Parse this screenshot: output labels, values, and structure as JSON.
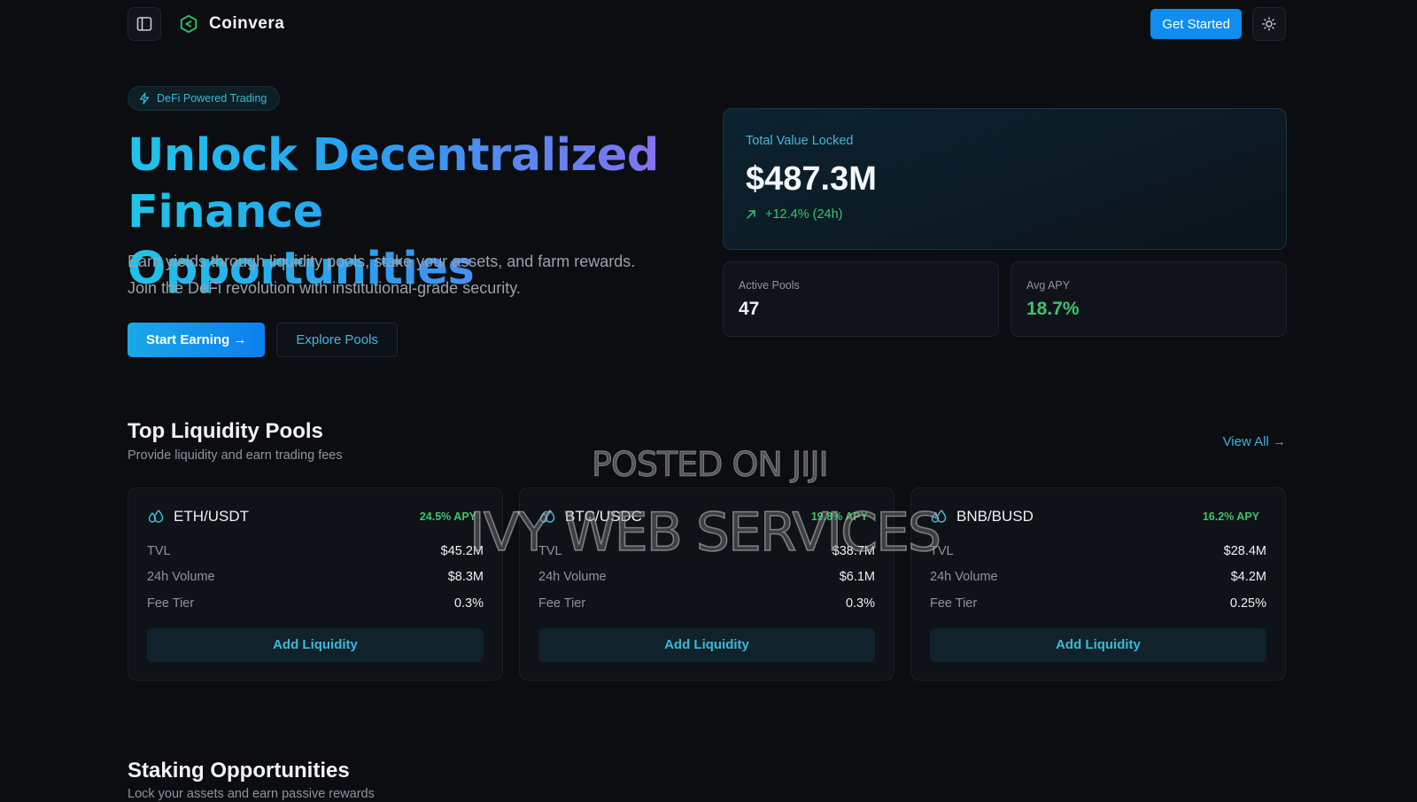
{
  "nav": {
    "brand_name": "Coinvera",
    "cta_label": "Get Started"
  },
  "hero": {
    "badge": "DeFi Powered Trading",
    "title_line1": "Unlock Decentralized",
    "title_line2": "Finance Opportunities",
    "description": "Earn yields through liquidity pools, stake your assets, and farm rewards. Join the DeFi revolution with institutional-grade security.",
    "start_label": "Start Earning →",
    "explore_label": "Explore Pools"
  },
  "tvl": {
    "label": "Total Value Locked",
    "value": "$487.3M",
    "change": "+12.4% (24h)"
  },
  "stats": [
    {
      "label": "Active Pools",
      "value": "47"
    },
    {
      "label": "Avg APY",
      "value": "18.7%"
    }
  ],
  "pools_section": {
    "title": "Top Liquidity Pools",
    "subtitle": "Provide liquidity and earn trading fees",
    "view_all": "View All →"
  },
  "pools": [
    {
      "name": "ETH/USDT",
      "apy": "24.5% APY",
      "rows": [
        [
          "TVL",
          "$45.2M"
        ],
        [
          "24h Volume",
          "$8.3M"
        ],
        [
          "Fee Tier",
          "0.3%"
        ]
      ],
      "button": "Add Liquidity"
    },
    {
      "name": "BTC/USDC",
      "apy": "19.8% APY",
      "rows": [
        [
          "TVL",
          "$38.7M"
        ],
        [
          "24h Volume",
          "$6.1M"
        ],
        [
          "Fee Tier",
          "0.3%"
        ]
      ],
      "button": "Add Liquidity"
    },
    {
      "name": "BNB/BUSD",
      "apy": "16.2% APY",
      "rows": [
        [
          "TVL",
          "$28.4M"
        ],
        [
          "24h Volume",
          "$4.2M"
        ],
        [
          "Fee Tier",
          "0.25%"
        ]
      ],
      "button": "Add Liquidity"
    }
  ],
  "staking_section": {
    "title": "Staking Opportunities",
    "subtitle": "Lock your assets and earn passive rewards"
  },
  "watermark": {
    "line1": "POSTED ON JIJI",
    "line2": "IVY WEB SERVICES"
  },
  "colors": {
    "background": "#0b0d11",
    "accent": "#0f8ef0",
    "cyan": "#44b7d8",
    "green": "#3cc46a"
  },
  "icons": {
    "sidebar_toggle": "sidebar-toggle-icon",
    "logo": "coinvera-logo-icon",
    "theme": "sun-icon",
    "badge": "lightning-icon",
    "trend": "arrow-up-right-icon",
    "pool": "droplets-icon"
  }
}
